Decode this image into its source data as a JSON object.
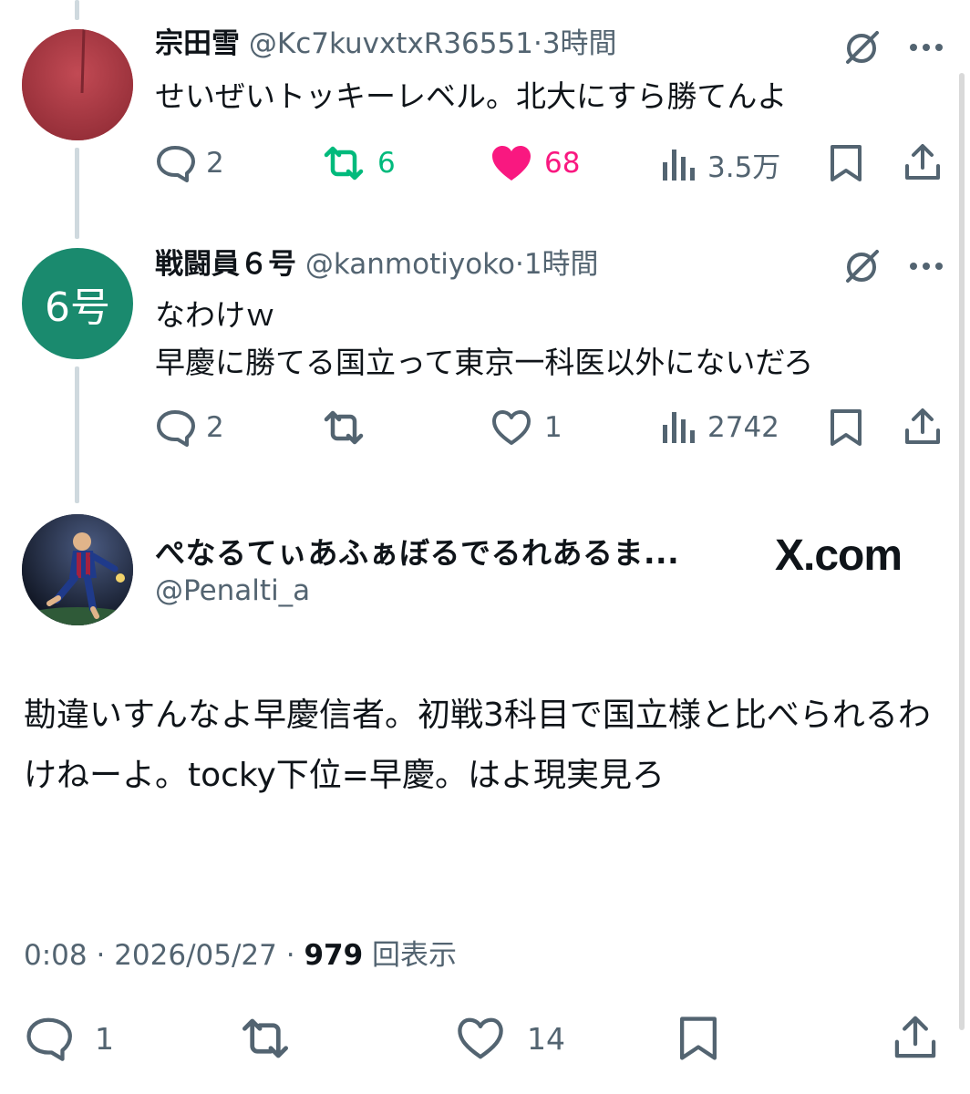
{
  "replies": [
    {
      "name": "宗田雪",
      "handle": "@Kc7kuvxtxR36551",
      "time": "3時間",
      "lines": [
        "せいぜいトッキーレベル。北大にすら勝てんよ"
      ],
      "replies": "2",
      "retweets": "6",
      "likes": "68",
      "views": "3.5万",
      "retweeted": true,
      "liked": true,
      "avatar_color": "#b2404a"
    },
    {
      "name": "戦闘員６号",
      "handle": "@kanmotiyoko",
      "time": "1時間",
      "lines": [
        "なわけｗ",
        "早慶に勝てる国立って東京一科医以外にないだろ"
      ],
      "replies": "2",
      "retweets": "",
      "likes": "1",
      "views": "2742",
      "retweeted": false,
      "liked": false,
      "avatar_text": "6号",
      "avatar_color": "#1a8a6e"
    }
  ],
  "main": {
    "name": "ぺなるてぃあふぁぼるでるれあるま...",
    "handle": "@Penalti_a",
    "source": "X.com",
    "text": "勘違いすんなよ早慶信者。初戦3科目で国立様と比べられるわけねーよ。tocky下位=早慶。はよ現実見ろ",
    "time": "0:08",
    "date": "2026/05/27",
    "views": "979",
    "views_label": "回表示",
    "replies": "1",
    "likes": "14"
  },
  "colors": {
    "text": "#0f1419",
    "secondary": "#536471",
    "retweet_active": "#00ba7c",
    "like_active": "#f91880",
    "thread_line": "#cfd9de"
  },
  "icons": [
    "reply-icon",
    "retweet-icon",
    "like-icon",
    "views-icon",
    "bookmark-icon",
    "share-icon",
    "grok-icon",
    "more-icon",
    "x-logo"
  ]
}
